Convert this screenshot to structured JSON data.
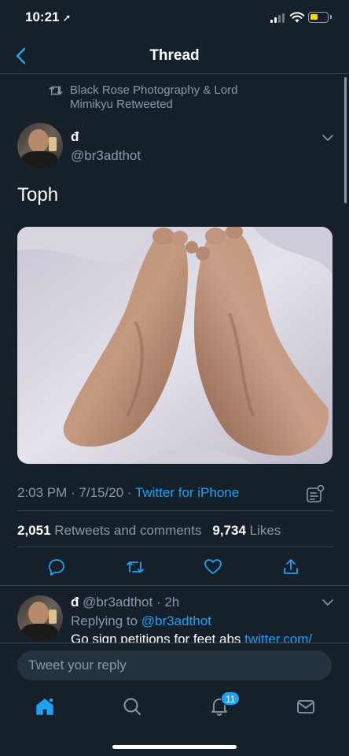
{
  "status_bar": {
    "time": "10:21",
    "location_icon": "location-arrow-icon"
  },
  "nav": {
    "title": "Thread",
    "back_icon": "back-chevron-icon"
  },
  "retweet_banner": {
    "text": "Black Rose Photography & Lord Mimikyu Retweeted",
    "icon": "retweet-icon"
  },
  "tweet": {
    "author_name": "đ",
    "author_handle": "@br3adthot",
    "text": "Toph",
    "image_alt": "photo",
    "timestamp": "2:03 PM · 7/15/20 · ",
    "source": "Twitter for iPhone",
    "retweets_count": "2,051",
    "retweets_label": "Retweets and comments",
    "likes_count": "9,734",
    "likes_label": "Likes",
    "actions": [
      "reply-icon",
      "retweet-icon",
      "like-icon",
      "share-icon"
    ]
  },
  "reply": {
    "author_name": "đ",
    "author_handle": "@br3adthot",
    "time": "· 2h",
    "replying_prefix": "Replying to ",
    "replying_to": "@br3adthot",
    "text": "Go sign petitions for feet abs ",
    "link": "twitter.com/"
  },
  "compose": {
    "placeholder": "Tweet your reply"
  },
  "tabs": [
    {
      "name": "home",
      "icon": "home-icon",
      "active": true
    },
    {
      "name": "search",
      "icon": "search-icon",
      "active": false
    },
    {
      "name": "notifications",
      "icon": "bell-icon",
      "active": false,
      "badge": "11"
    },
    {
      "name": "messages",
      "icon": "mail-icon",
      "active": false
    }
  ],
  "colors": {
    "background": "#15202b",
    "accent": "#1da1f2",
    "secondary_text": "#8899a6",
    "divider": "#38444d"
  }
}
